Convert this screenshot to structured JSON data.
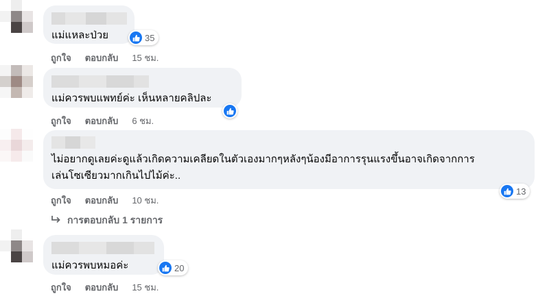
{
  "comments": [
    {
      "text": "แม่แหละป่วย",
      "reactions": "35",
      "like": "ถูกใจ",
      "reply": "ตอบกลับ",
      "time": "15 ชม."
    },
    {
      "text": "แม่ควรพบแพทย์ค่ะ เห็นหลายคลิปละ",
      "reactions": "",
      "like": "ถูกใจ",
      "reply": "ตอบกลับ",
      "time": "6 ชม."
    },
    {
      "text_line1": "ไม่อยากดูเลยค่ะดูแล้วเกิดความเคลียดในตัวเองมากๆหลังๆน้องมีอาการรุนแรงขึ้นอาจเกิดจากการ",
      "text_line2": "เล่นโซเซียวมากเกินไปไม้ค่ะ..",
      "reactions": "13",
      "like": "ถูกใจ",
      "reply": "ตอบกลับ",
      "time": "10 ชม.",
      "replies_label": "การตอบกลับ 1 รายการ"
    },
    {
      "text": "แม่ควรพบหมอค่ะ",
      "reactions": "20",
      "like": "ถูกใจ",
      "reply": "ตอบกลับ",
      "time": "15 ชม."
    }
  ],
  "icons": {
    "like": "thumbs-up-icon",
    "reply_arrow": "reply-arrow-icon"
  },
  "colors": {
    "like_blue": "#1877f2",
    "bubble": "#f0f2f5",
    "meta_text": "#65676b"
  }
}
